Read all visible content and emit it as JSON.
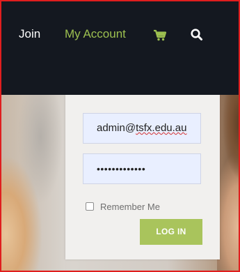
{
  "nav": {
    "join_label": "Join",
    "account_label": "My Account",
    "cart_icon": "cart-icon",
    "search_icon": "search-icon"
  },
  "login": {
    "email_value": "admin@tsfx.edu.au",
    "email_user": "admin@",
    "email_domain": "tsfx.edu.au",
    "password_masked": "•••••••••••••",
    "remember_label": "Remember Me",
    "remember_checked": false,
    "button_label": "LOG IN"
  },
  "colors": {
    "nav_background": "#141820",
    "account_link": "#9dc050",
    "accent_button": "#a9c45c",
    "field_background": "#e9efff",
    "frame_border": "#e01e1e"
  }
}
